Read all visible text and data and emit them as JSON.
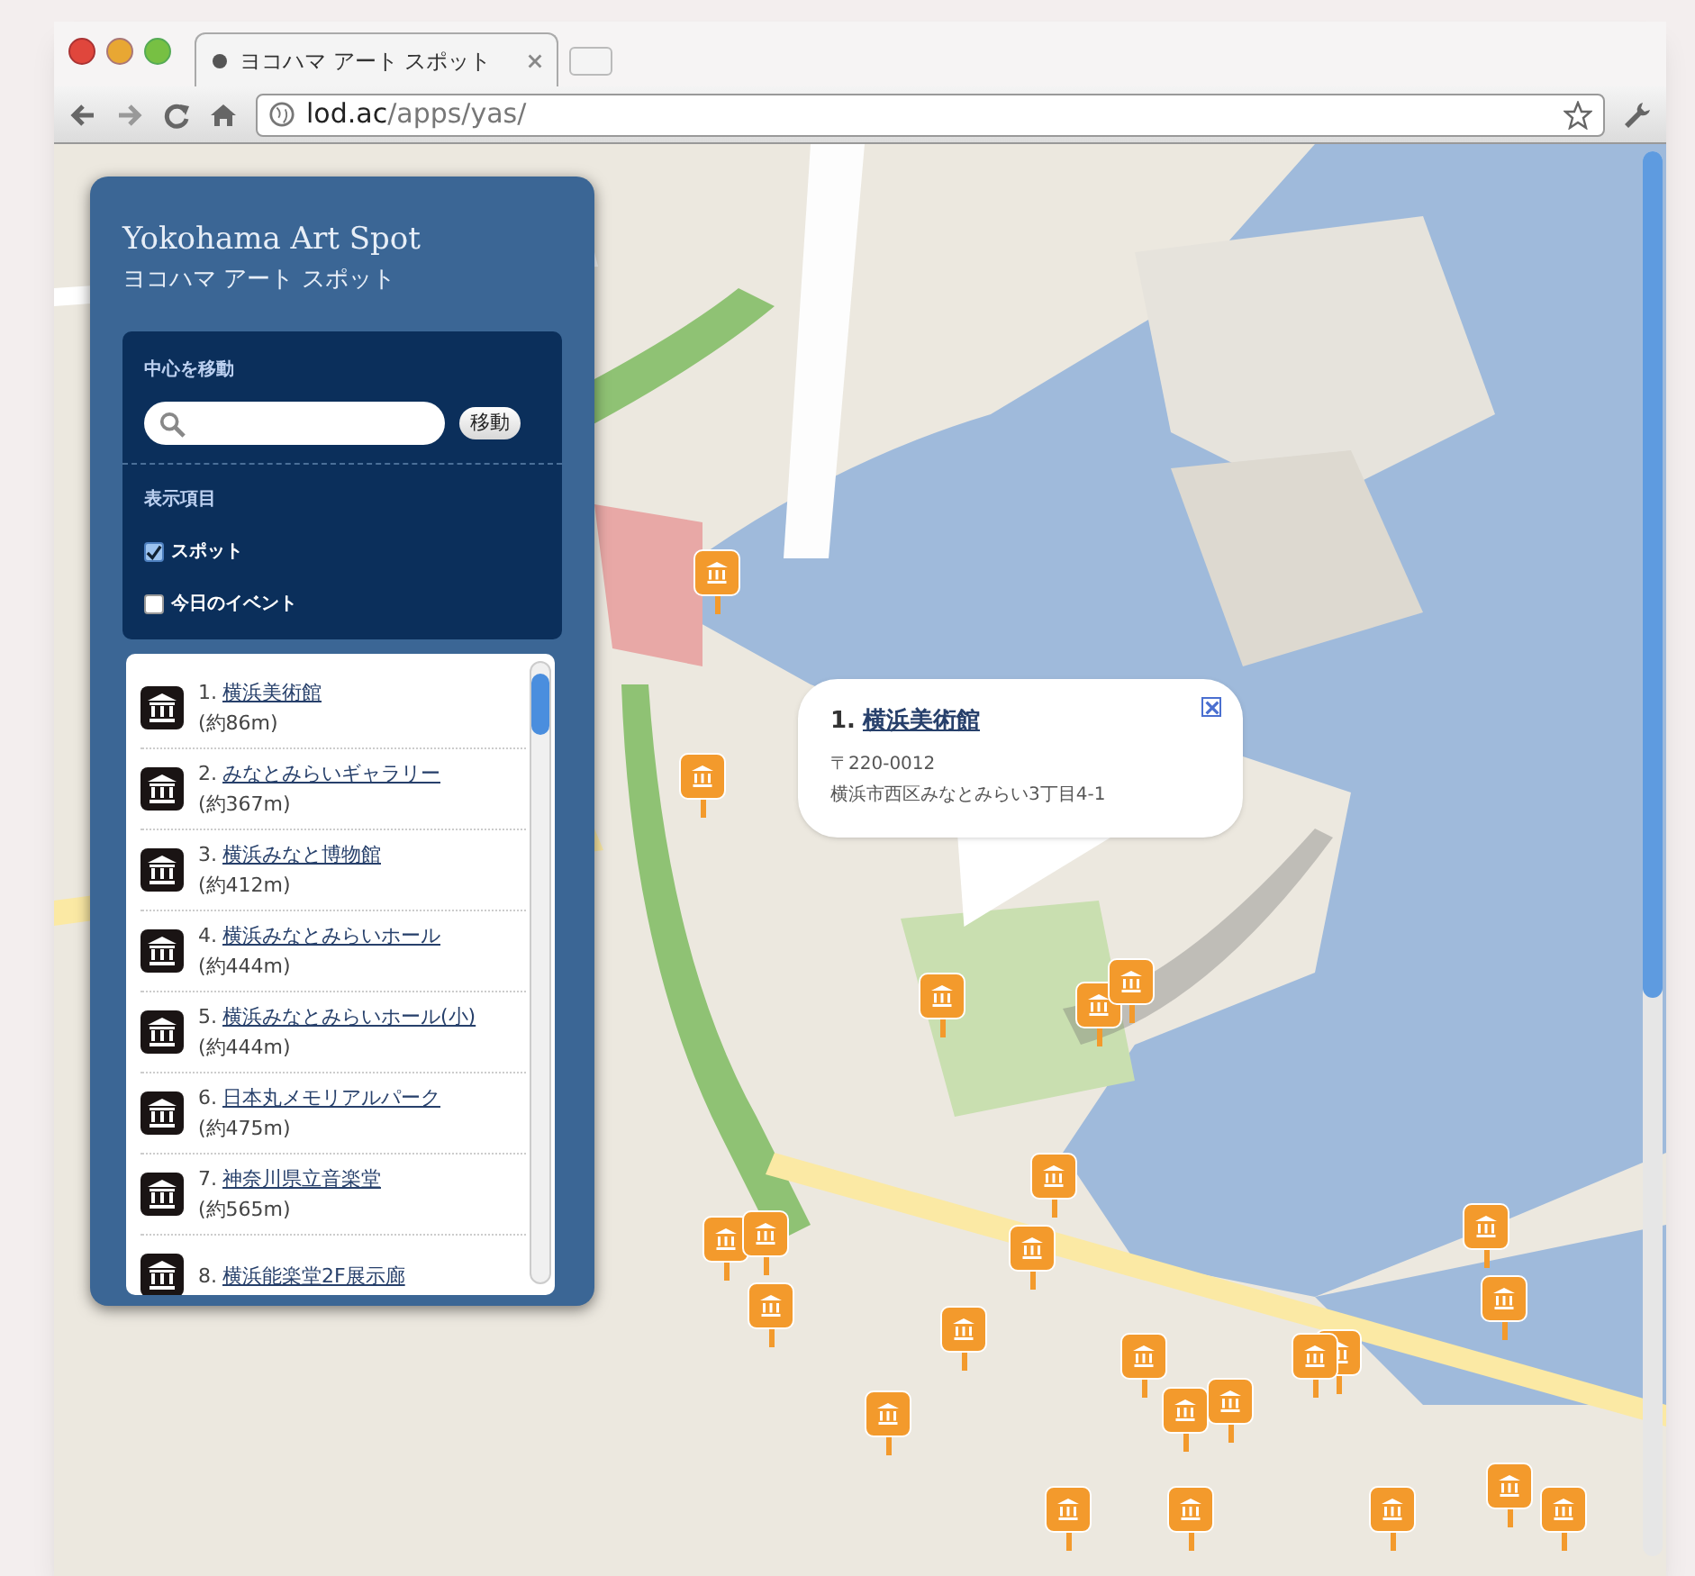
{
  "browser": {
    "tab": {
      "title": "ヨコハマ アート スポット"
    },
    "address": {
      "host": "lod.ac",
      "path": "/apps/yas/"
    }
  },
  "panel": {
    "title": "Yokohama Art Spot",
    "subtitle": "ヨコハマ アート スポット",
    "search": {
      "heading": "中心を移動",
      "button": "移動"
    },
    "display": {
      "heading": "表示項目",
      "options": [
        {
          "label": "スポット",
          "checked": true
        },
        {
          "label": "今日のイベント",
          "checked": false
        }
      ]
    },
    "spots": [
      {
        "number": "1.",
        "name": "横浜美術館",
        "distance": "(約86m)"
      },
      {
        "number": "2.",
        "name": "みなとみらいギャラリー",
        "distance": "(約367m)"
      },
      {
        "number": "3.",
        "name": "横浜みなと博物館",
        "distance": "(約412m)"
      },
      {
        "number": "4.",
        "name": "横浜みなとみらいホール",
        "distance": "(約444m)"
      },
      {
        "number": "5.",
        "name": "横浜みなとみらいホール(小)",
        "distance": "(約444m)"
      },
      {
        "number": "6.",
        "name": "日本丸メモリアルパーク",
        "distance": "(約475m)"
      },
      {
        "number": "7.",
        "name": "神奈川県立音楽堂",
        "distance": "(約565m)"
      },
      {
        "number": "8.",
        "name": "横浜能楽堂2F展示廊"
      }
    ]
  },
  "info_window": {
    "number": "1.",
    "name": "横浜美術館",
    "postal": "〒220-0012",
    "address": "横浜市西区みなとみらい3丁目4-1"
  }
}
